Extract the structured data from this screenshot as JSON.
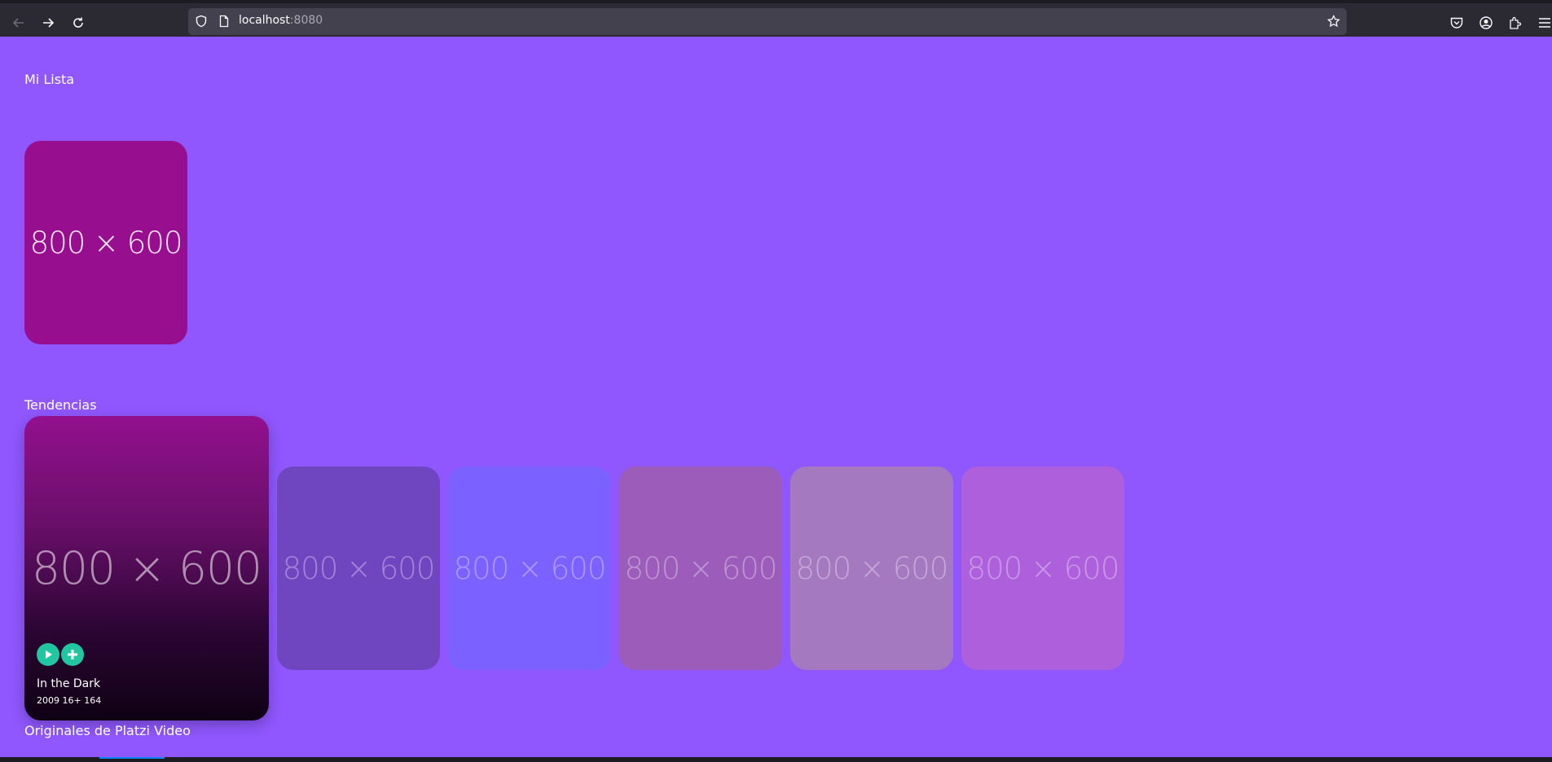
{
  "browser": {
    "url_host": "localhost",
    "url_port": ":8080",
    "icons": [
      "back-icon",
      "forward-icon",
      "reload-icon",
      "shield-icon",
      "page-icon",
      "bookmark-star-icon",
      "pocket-icon",
      "account-icon",
      "extensions-icon",
      "menu-icon"
    ]
  },
  "sections": {
    "mi_lista": {
      "title": "Mi Lista"
    },
    "tendencias": {
      "title": "Tendencias"
    },
    "originales": {
      "title": "Originales de Platzi Video"
    }
  },
  "mi_lista_cards": [
    {
      "placeholder": "800 × 600",
      "color": "#970f8f"
    }
  ],
  "featured_card": {
    "placeholder": "800 × 600",
    "title": "In the Dark",
    "meta": "2009 16+ 164",
    "play_icon": "play-icon",
    "add_icon": "plus-icon"
  },
  "tendencias_cards": [
    {
      "placeholder": "800 × 600",
      "color": "#7045c0"
    },
    {
      "placeholder": "800 × 600",
      "color": "#7b61ff"
    },
    {
      "placeholder": "800 × 600",
      "color": "#9b5cba"
    },
    {
      "placeholder": "800 × 600",
      "color": "#a479c0"
    },
    {
      "placeholder": "800 × 600",
      "color": "#ae60dc"
    }
  ]
}
